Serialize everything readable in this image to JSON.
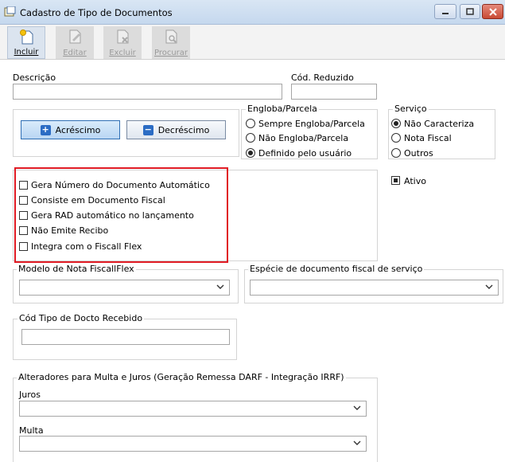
{
  "window": {
    "title": "Cadastro de Tipo de Documentos"
  },
  "toolbar": {
    "buttons": [
      {
        "label": "Incluir",
        "state": "active"
      },
      {
        "label": "Editar",
        "state": "disabled"
      },
      {
        "label": "Excluir",
        "state": "disabled"
      },
      {
        "label": "Procurar",
        "state": "disabled"
      }
    ]
  },
  "form": {
    "descricao_label": "Descrição",
    "descricao_value": "",
    "cod_reduzido_label": "Cód. Reduzido",
    "cod_reduzido_value": "",
    "acrescimo_label": "Acréscimo",
    "decrescimo_label": "Decréscimo",
    "engloba": {
      "title": "Engloba/Parcela",
      "options": [
        "Sempre Engloba/Parcela",
        "Não Engloba/Parcela",
        "Definido pelo usuário"
      ],
      "selected": 2
    },
    "servico": {
      "title": "Serviço",
      "options": [
        "Não Caracteriza",
        "Nota Fiscal",
        "Outros"
      ],
      "selected": 0
    },
    "checkboxes": [
      "Gera Número do Documento Automático",
      "Consiste em Documento Fiscal",
      "Gera RAD automático no lançamento",
      "Não Emite Recibo",
      "Integra com o Fiscall Flex"
    ],
    "ativo_label": "Ativo",
    "modelo_label": "Modelo de Nota FiscallFlex",
    "modelo_value": "",
    "especie_label": "Espécie de documento fiscal de serviço",
    "especie_value": "",
    "cod_tipo_label": "Cód Tipo de Docto Recebido",
    "cod_tipo_value": "",
    "alteradores_label": "Alteradores para Multa e Juros (Geração Remessa DARF - Integração IRRF)",
    "juros_label": "Juros",
    "juros_value": "",
    "multa_label": "Multa",
    "multa_value": ""
  },
  "colors": {
    "highlight_border": "#e01b24",
    "accent_blue": "#2b6cc4"
  }
}
